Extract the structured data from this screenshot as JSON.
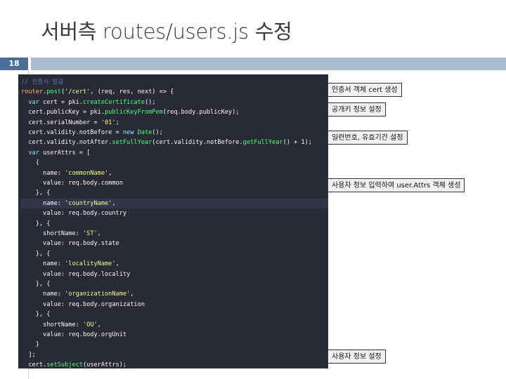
{
  "slide": {
    "title": "서버측 routes/users.js 수정",
    "page_number": "18"
  },
  "code": {
    "lines": [
      [
        {
          "t": "// 인증서 발급",
          "c": "cm"
        }
      ],
      [
        {
          "t": "router",
          "c": "vr"
        },
        {
          "t": ".",
          "c": "pn"
        },
        {
          "t": "post",
          "c": "fn"
        },
        {
          "t": "(",
          "c": "pn"
        },
        {
          "t": "'/cert'",
          "c": "st"
        },
        {
          "t": ", (req, res, next) => {",
          "c": "pn"
        }
      ],
      [
        {
          "t": "  ",
          "c": "pn"
        },
        {
          "t": "var",
          "c": "kw"
        },
        {
          "t": " cert = pki.",
          "c": "pn"
        },
        {
          "t": "createCertificate",
          "c": "fn"
        },
        {
          "t": "();",
          "c": "pn"
        }
      ],
      [
        {
          "t": "  cert.publicKey = pki.",
          "c": "pn"
        },
        {
          "t": "publicKeyFromPem",
          "c": "fn"
        },
        {
          "t": "(req.body.publicKey);",
          "c": "pn"
        }
      ],
      [
        {
          "t": "  cert.serialNumber = ",
          "c": "pn"
        },
        {
          "t": "'01'",
          "c": "st"
        },
        {
          "t": ";",
          "c": "pn"
        }
      ],
      [
        {
          "t": "  cert.validity.notBefore = ",
          "c": "pn"
        },
        {
          "t": "new",
          "c": "kw"
        },
        {
          "t": " ",
          "c": "pn"
        },
        {
          "t": "Date",
          "c": "fn"
        },
        {
          "t": "();",
          "c": "pn"
        }
      ],
      [
        {
          "t": "  cert.validity.notAfter.",
          "c": "pn"
        },
        {
          "t": "setFullYear",
          "c": "fn"
        },
        {
          "t": "(cert.validity.notBefore.",
          "c": "pn"
        },
        {
          "t": "getFullYear",
          "c": "fn"
        },
        {
          "t": "() + 1);",
          "c": "pn"
        }
      ],
      [
        {
          "t": "  ",
          "c": "pn"
        },
        {
          "t": "var",
          "c": "kw"
        },
        {
          "t": " userAttrs = [",
          "c": "pn"
        }
      ],
      [
        {
          "t": "    {",
          "c": "pn"
        }
      ],
      [
        {
          "t": "      name: ",
          "c": "pn"
        },
        {
          "t": "'commonName'",
          "c": "st"
        },
        {
          "t": ",",
          "c": "pn"
        }
      ],
      [
        {
          "t": "      value: req.body.common",
          "c": "pn"
        }
      ],
      [
        {
          "t": "    }, {",
          "c": "pn"
        }
      ],
      [
        {
          "t": "      name: ",
          "c": "pn"
        },
        {
          "t": "'countryName'",
          "c": "st"
        },
        {
          "t": ",",
          "c": "pn"
        }
      ],
      [
        {
          "t": "      value: req.body.country",
          "c": "pn"
        }
      ],
      [
        {
          "t": "    }, {",
          "c": "pn"
        }
      ],
      [
        {
          "t": "      shortName: ",
          "c": "pn"
        },
        {
          "t": "'ST'",
          "c": "st"
        },
        {
          "t": ",",
          "c": "pn"
        }
      ],
      [
        {
          "t": "      value: req.body.state",
          "c": "pn"
        }
      ],
      [
        {
          "t": "    }, {",
          "c": "pn"
        }
      ],
      [
        {
          "t": "      name: ",
          "c": "pn"
        },
        {
          "t": "'localityName'",
          "c": "st"
        },
        {
          "t": ",",
          "c": "pn"
        }
      ],
      [
        {
          "t": "      value: req.body.locality",
          "c": "pn"
        }
      ],
      [
        {
          "t": "    }, {",
          "c": "pn"
        }
      ],
      [
        {
          "t": "      name: ",
          "c": "pn"
        },
        {
          "t": "'organizationName'",
          "c": "st"
        },
        {
          "t": ",",
          "c": "pn"
        }
      ],
      [
        {
          "t": "      value: req.body.organization",
          "c": "pn"
        }
      ],
      [
        {
          "t": "    }, {",
          "c": "pn"
        }
      ],
      [
        {
          "t": "      shortName: ",
          "c": "pn"
        },
        {
          "t": "'OU'",
          "c": "st"
        },
        {
          "t": ",",
          "c": "pn"
        }
      ],
      [
        {
          "t": "      value: req.body.orgUnit",
          "c": "pn"
        }
      ],
      [
        {
          "t": "    }",
          "c": "pn"
        }
      ],
      [
        {
          "t": "  ];",
          "c": "pn"
        }
      ],
      [
        {
          "t": "  cert.",
          "c": "pn"
        },
        {
          "t": "setSubject",
          "c": "fn"
        },
        {
          "t": "(userAttrs);",
          "c": "pn"
        }
      ]
    ]
  },
  "notes": {
    "cert_object": "인증서 객체 cert 생성",
    "public_key": "공개키 정보 설정",
    "serial_validity": "일련번호, 유효기간 설정",
    "user_attrs": "사용자 정보 입력하여 user.Attrs 객체 생성",
    "user_info": "사용자 정보 설정"
  },
  "colors": {
    "header_bar": "#a9bcd0",
    "page_number_bg": "#4a6e98",
    "code_background": "#282a36"
  }
}
